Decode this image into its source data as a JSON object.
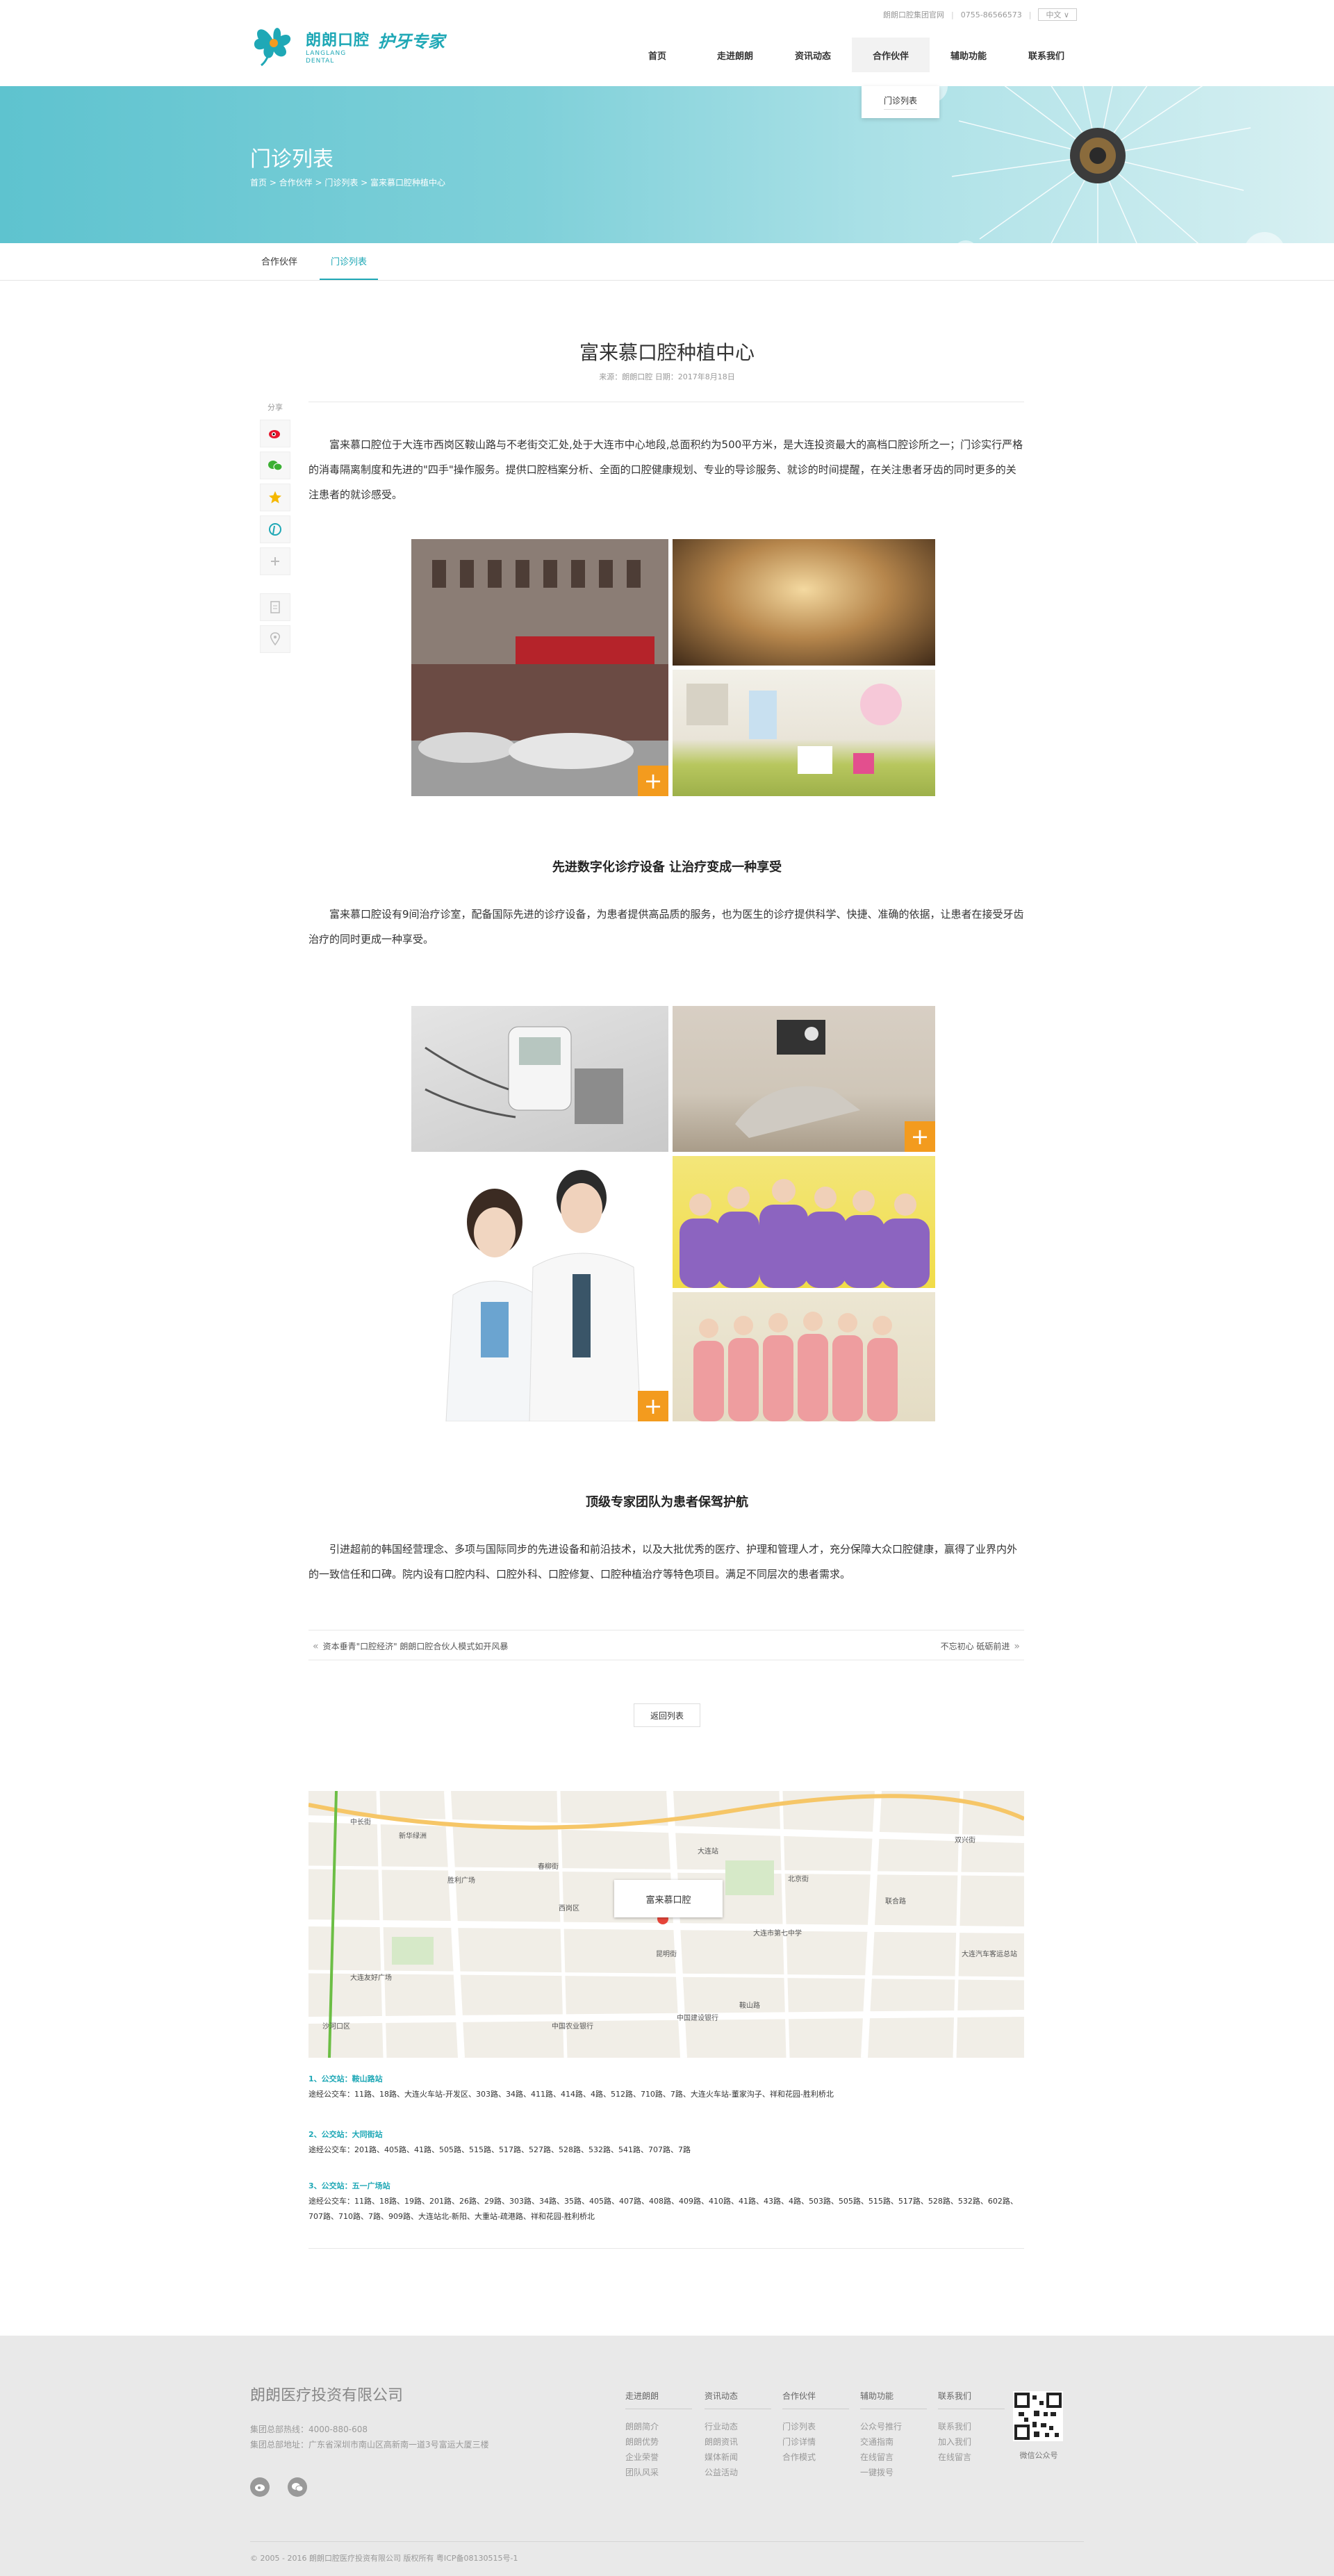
{
  "header": {
    "logo_name": "朗朗口腔",
    "logo_sub": "LANGLANG DENTAL",
    "slogan": "护牙专家",
    "toplinks": [
      "朗朗口腔集团官网",
      "0755-86566573"
    ],
    "lang": "中文 ∨",
    "nav": [
      "首页",
      "走进朗朗",
      "资讯动态",
      "合作伙伴",
      "辅助功能",
      "联系我们"
    ],
    "nav_active": "合作伙伴",
    "dropdown_item": "门诊列表"
  },
  "banner": {
    "title": "门诊列表",
    "breadcrumb": "首页 > 合作伙伴 > 门诊列表 > 富来慕口腔种植中心"
  },
  "subnav": [
    "合作伙伴",
    "门诊列表"
  ],
  "article": {
    "title": "富来慕口腔种植中心",
    "meta": "来源：朗朗口腔    日期：2017年8月18日",
    "share_label": "分享",
    "intro": "富来慕口腔位于大连市西岗区鞍山路与不老街交汇处,处于大连市中心地段,总面积约为500平方米，是大连投资最大的高档口腔诊所之一；门诊实行严格的消毒隔离制度和先进的\"四手\"操作服务。提供口腔档案分析、全面的口腔健康规划、专业的导诊服务、就诊的时间提醒，在关注患者牙齿的同时更多的关注患者的就诊感受。",
    "section1_title": "先进数字化诊疗设备  让治疗变成一种享受",
    "section1_text": "富来慕口腔设有9间治疗诊室，配备国际先进的诊疗设备，为患者提供高品质的服务，也为医生的诊疗提供科学、快捷、准确的依据，让患者在接受牙齿治疗的同时更成一种享受。",
    "section2_title": "顶级专家团队为患者保驾护航",
    "section2_text": "引进超前的韩国经营理念、多项与国际同步的先进设备和前沿技术，以及大批优秀的医疗、护理和管理人才，充分保障大众口腔健康，赢得了业界内外的一致信任和口碑。院内设有口腔内科、口腔外科、口腔修复、口腔种植治疗等特色项目。满足不同层次的患者需求。",
    "prev": "资本垂青\"口腔经济\" 朗朗口腔合伙人模式如开风暴",
    "next": "不忘初心 砥砺前进",
    "back": "返回列表"
  },
  "map": {
    "popup": "富来慕口腔",
    "labels": [
      "中长街",
      "新华绿洲",
      "胜利广场",
      "春柳街",
      "双兴街",
      "北京街",
      "大连站",
      "联合路",
      "大连市第七中学",
      "昆明街",
      "西岗区",
      "鞍山路",
      "中国农业银行",
      "中国建设银行",
      "大连友好广场",
      "沙河口区",
      "大连汽车客运总站"
    ]
  },
  "routes": [
    {
      "title": "1、公交站：鞍山路站",
      "text": "途经公交车：11路、18路、大连火车站-开发区、303路、34路、411路、414路、4路、512路、710路、7路、大连火车站-董家沟子、祥和花园-胜利桥北"
    },
    {
      "title": "2、公交站：大同街站",
      "text": "途经公交车：201路、405路、41路、505路、515路、517路、527路、528路、532路、541路、707路、7路"
    },
    {
      "title": "3、公交站：五一广场站",
      "text": "途经公交车：11路、18路、19路、201路、26路、29路、303路、34路、35路、405路、407路、408路、409路、410路、41路、43路、4路、503路、505路、515路、517路、528路、532路、602路、707路、710路、7路、909路、大连站北-新阳、大重站-疏港路、祥和花园-胜利桥北"
    }
  ],
  "footer": {
    "company": "朗朗医疗投资有限公司",
    "hotline": "集团总部热线：4000-880-608",
    "address": "集团总部地址：广东省深圳市南山区高新南一道3号富运大厦三楼",
    "cols": [
      {
        "head": "走进朗朗",
        "items": [
          "朗朗简介",
          "朗朗优势",
          "企业荣誉",
          "团队风采"
        ]
      },
      {
        "head": "资讯动态",
        "items": [
          "行业动态",
          "朗朗资讯",
          "媒体新闻",
          "公益活动"
        ]
      },
      {
        "head": "合作伙伴",
        "items": [
          "门诊列表",
          "门诊详情",
          "合作模式"
        ]
      },
      {
        "head": "辅助功能",
        "items": [
          "公众号推行",
          "交通指南",
          "在线留言",
          "一键拨号"
        ]
      },
      {
        "head": "联系我们",
        "items": [
          "联系我们",
          "加入我们",
          "在线留言"
        ]
      }
    ],
    "qr_label": "微信公众号",
    "copyright": "© 2005 - 2016 朗朗口腔医疗投资有限公司 版权所有 粤ICP备08130515号-1"
  },
  "colors": {
    "accent": "#1fa8b6",
    "plus": "#f39b1e",
    "footer_bg": "#e9e9e9"
  }
}
